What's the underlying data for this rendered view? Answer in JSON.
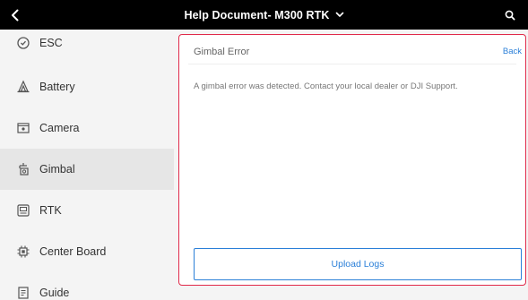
{
  "header": {
    "title": "Help Document- M300 RTK",
    "back_icon": "chevron-left-icon",
    "title_dropdown_icon": "chevron-down-icon",
    "search_icon": "search-icon"
  },
  "sidebar": {
    "items": [
      {
        "label": "ESC",
        "icon": "esc-icon",
        "active": false
      },
      {
        "label": "Battery",
        "icon": "battery-icon",
        "active": false
      },
      {
        "label": "Camera",
        "icon": "camera-icon",
        "active": false
      },
      {
        "label": "Gimbal",
        "icon": "gimbal-icon",
        "active": true
      },
      {
        "label": "RTK",
        "icon": "rtk-icon",
        "active": false
      },
      {
        "label": "Center Board",
        "icon": "center-board-icon",
        "active": false
      },
      {
        "label": "Guide",
        "icon": "guide-icon",
        "active": false
      }
    ]
  },
  "content": {
    "title": "Gimbal Error",
    "back_label": "Back",
    "message": "A gimbal error was detected. Contact your local dealer or DJI Support.",
    "upload_label": "Upload Logs"
  },
  "colors": {
    "header_bg": "#000000",
    "accent_blue": "#2a7fd8",
    "error_border": "#e02a4a",
    "sidebar_active_bg": "#e6e6e6"
  }
}
